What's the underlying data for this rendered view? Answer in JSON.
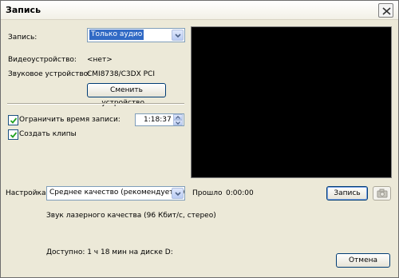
{
  "window": {
    "title": "Запись"
  },
  "record": {
    "label": "Запись:",
    "mode": "Только аудио"
  },
  "devices": {
    "video_label": "Видеоустройство:",
    "video_value": "<нет>",
    "audio_label": "Звуковое устройство:",
    "audio_value": "CMI8738/C3DX PCI",
    "change_button": "Сменить устройство..."
  },
  "options": {
    "limit_time_label": "Ограничить время записи:",
    "limit_time_checked": true,
    "limit_time_value": "1:18:37",
    "create_clips_label": "Создать клипы",
    "create_clips_checked": true
  },
  "settings": {
    "label": "Настройка:",
    "quality": "Среднее качество (рекомендуется)",
    "description": "Звук лазерного качества (96 Кбит/с, стерео)"
  },
  "elapsed": {
    "label": "Прошло",
    "value": "0:00:00"
  },
  "buttons": {
    "record": "Запись",
    "cancel": "Отмена"
  },
  "status": {
    "available": "Доступно: 1 ч 18 мин на диске D:"
  },
  "icons": {
    "close": "close-icon",
    "dropdown": "chevron-down-icon",
    "camera": "camera-icon"
  }
}
